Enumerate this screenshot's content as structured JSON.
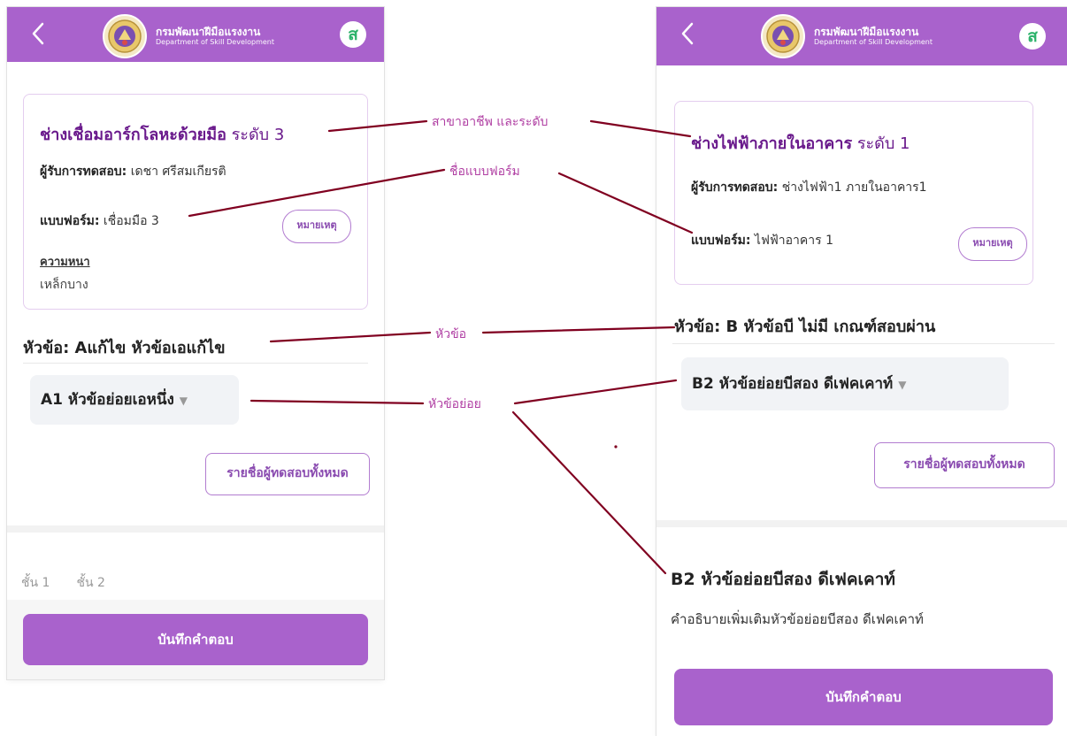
{
  "colors": {
    "brand_purple": "#a962cc",
    "annotation": "#b03fa3",
    "line": "#800020"
  },
  "header": {
    "org_th": "กรมพัฒนาฝีมือแรงงาน",
    "org_en": "Department of Skill Development",
    "avatar_letter": "ส"
  },
  "left_screen": {
    "occupation_name": "ช่างเชื่อมอาร์กโลหะด้วยมือ",
    "level": "ระดับ 3",
    "examinee_label": "ผู้รับการทดสอบ:",
    "examinee_value": "เดชา ศรีสมเกียรติ",
    "form_label": "แบบฟอร์ม:",
    "form_value": "เชื่อมมือ 3",
    "remark_button": "หมายเหตุ",
    "thickness_label": "ความหนา",
    "thickness_value": "เหล็กบาง",
    "topic_heading": "หัวข้อ: Aแก้ไข หัวข้อเอแก้ไข",
    "subtopic_selected": "A1 หัวข้อย่อยเอหนึ่ง",
    "all_examinees_button": "รายชื่อผู้ทดสอบทั้งหมด",
    "floor_tabs": [
      "ชั้น 1",
      "ชั้น 2"
    ],
    "save_button": "บันทึกคำตอบ"
  },
  "right_screen": {
    "occupation_name": "ช่างไฟฟ้าภายในอาคาร",
    "level": "ระดับ 1",
    "examinee_label": "ผู้รับการทดสอบ:",
    "examinee_value": "ช่างไฟฟ้า1 ภายในอาคาร1",
    "form_label": "แบบฟอร์ม:",
    "form_value": "ไฟฟ้าอาคาร 1",
    "remark_button": "หมายเหตุ",
    "topic_heading": "หัวข้อ: B หัวข้อบี ไม่มี เกณฑ์สอบผ่าน",
    "subtopic_selected": "B2 หัวข้อย่อยบีสอง ดีเฟคเคาท์",
    "all_examinees_button": "รายชื่อผู้ทดสอบทั้งหมด",
    "detail_title": "B2 หัวข้อย่อยบีสอง ดีเฟคเคาท์",
    "detail_description": "คำอธิบายเพิ่มเติมหัวข้อย่อยบีสอง ดีเฟคเคาท์",
    "save_button": "บันทึกคำตอบ"
  },
  "annotations": {
    "occupation_and_level": "สาขาอาชีพ และระดับ",
    "form_name": "ชื่อแบบฟอร์ม",
    "topic": "หัวข้อ",
    "subtopic": "หัวข้อย่อย"
  }
}
